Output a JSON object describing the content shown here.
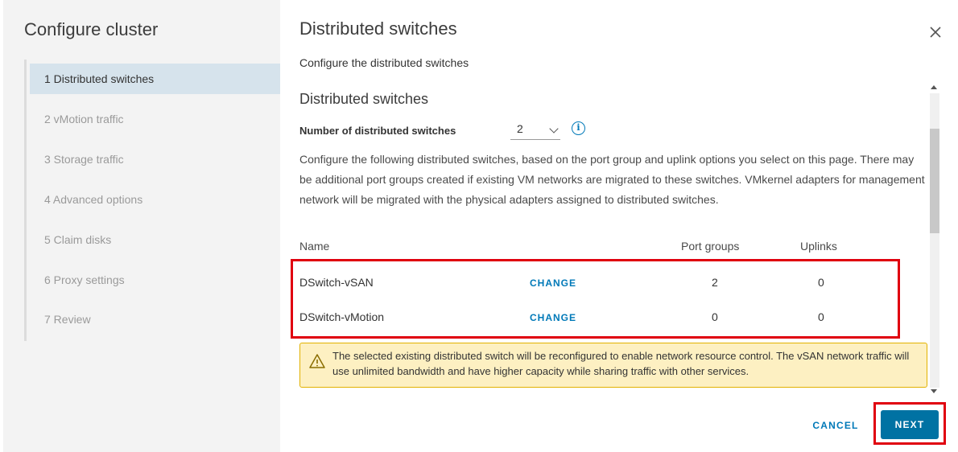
{
  "wizard": {
    "title": "Configure cluster",
    "steps": [
      {
        "label": "1  Distributed switches",
        "active": true
      },
      {
        "label": "2  vMotion traffic",
        "active": false
      },
      {
        "label": "3  Storage traffic",
        "active": false
      },
      {
        "label": "4  Advanced options",
        "active": false
      },
      {
        "label": "5  Claim disks",
        "active": false
      },
      {
        "label": "6  Proxy settings",
        "active": false
      },
      {
        "label": "7  Review",
        "active": false
      }
    ]
  },
  "page": {
    "title": "Distributed switches",
    "subtitle": "Configure the distributed switches",
    "close_icon": "close-icon"
  },
  "section": {
    "title": "Distributed switches",
    "num_switches_label": "Number of distributed switches",
    "num_switches_value": "2",
    "info_icon": "info-icon",
    "description": "Configure the following distributed switches, based on the port group and uplink options you select on this page. There may be additional port groups created if existing VM networks are migrated to these switches. VMkernel adapters for management network will be migrated with the physical adapters assigned to distributed switches."
  },
  "table": {
    "headers": {
      "name": "Name",
      "port_groups": "Port groups",
      "uplinks": "Uplinks"
    },
    "rows": [
      {
        "name": "DSwitch-vSAN",
        "action": "CHANGE",
        "port_groups": "2",
        "uplinks": "0"
      },
      {
        "name": "DSwitch-vMotion",
        "action": "CHANGE",
        "port_groups": "0",
        "uplinks": "0"
      }
    ]
  },
  "warning": {
    "icon": "warning-icon",
    "text": "The selected existing distributed switch will be reconfigured to enable network resource control. The vSAN network traffic will use unlimited bandwidth and have higher capacity while sharing traffic with other services."
  },
  "footer": {
    "cancel_label": "CANCEL",
    "next_label": "NEXT"
  },
  "colors": {
    "accent": "#0079b8",
    "primary_button": "#0072a3",
    "highlight": "#e0000f",
    "warning_bg": "#fdf0c2",
    "active_step_bg": "#d6e3ec"
  }
}
